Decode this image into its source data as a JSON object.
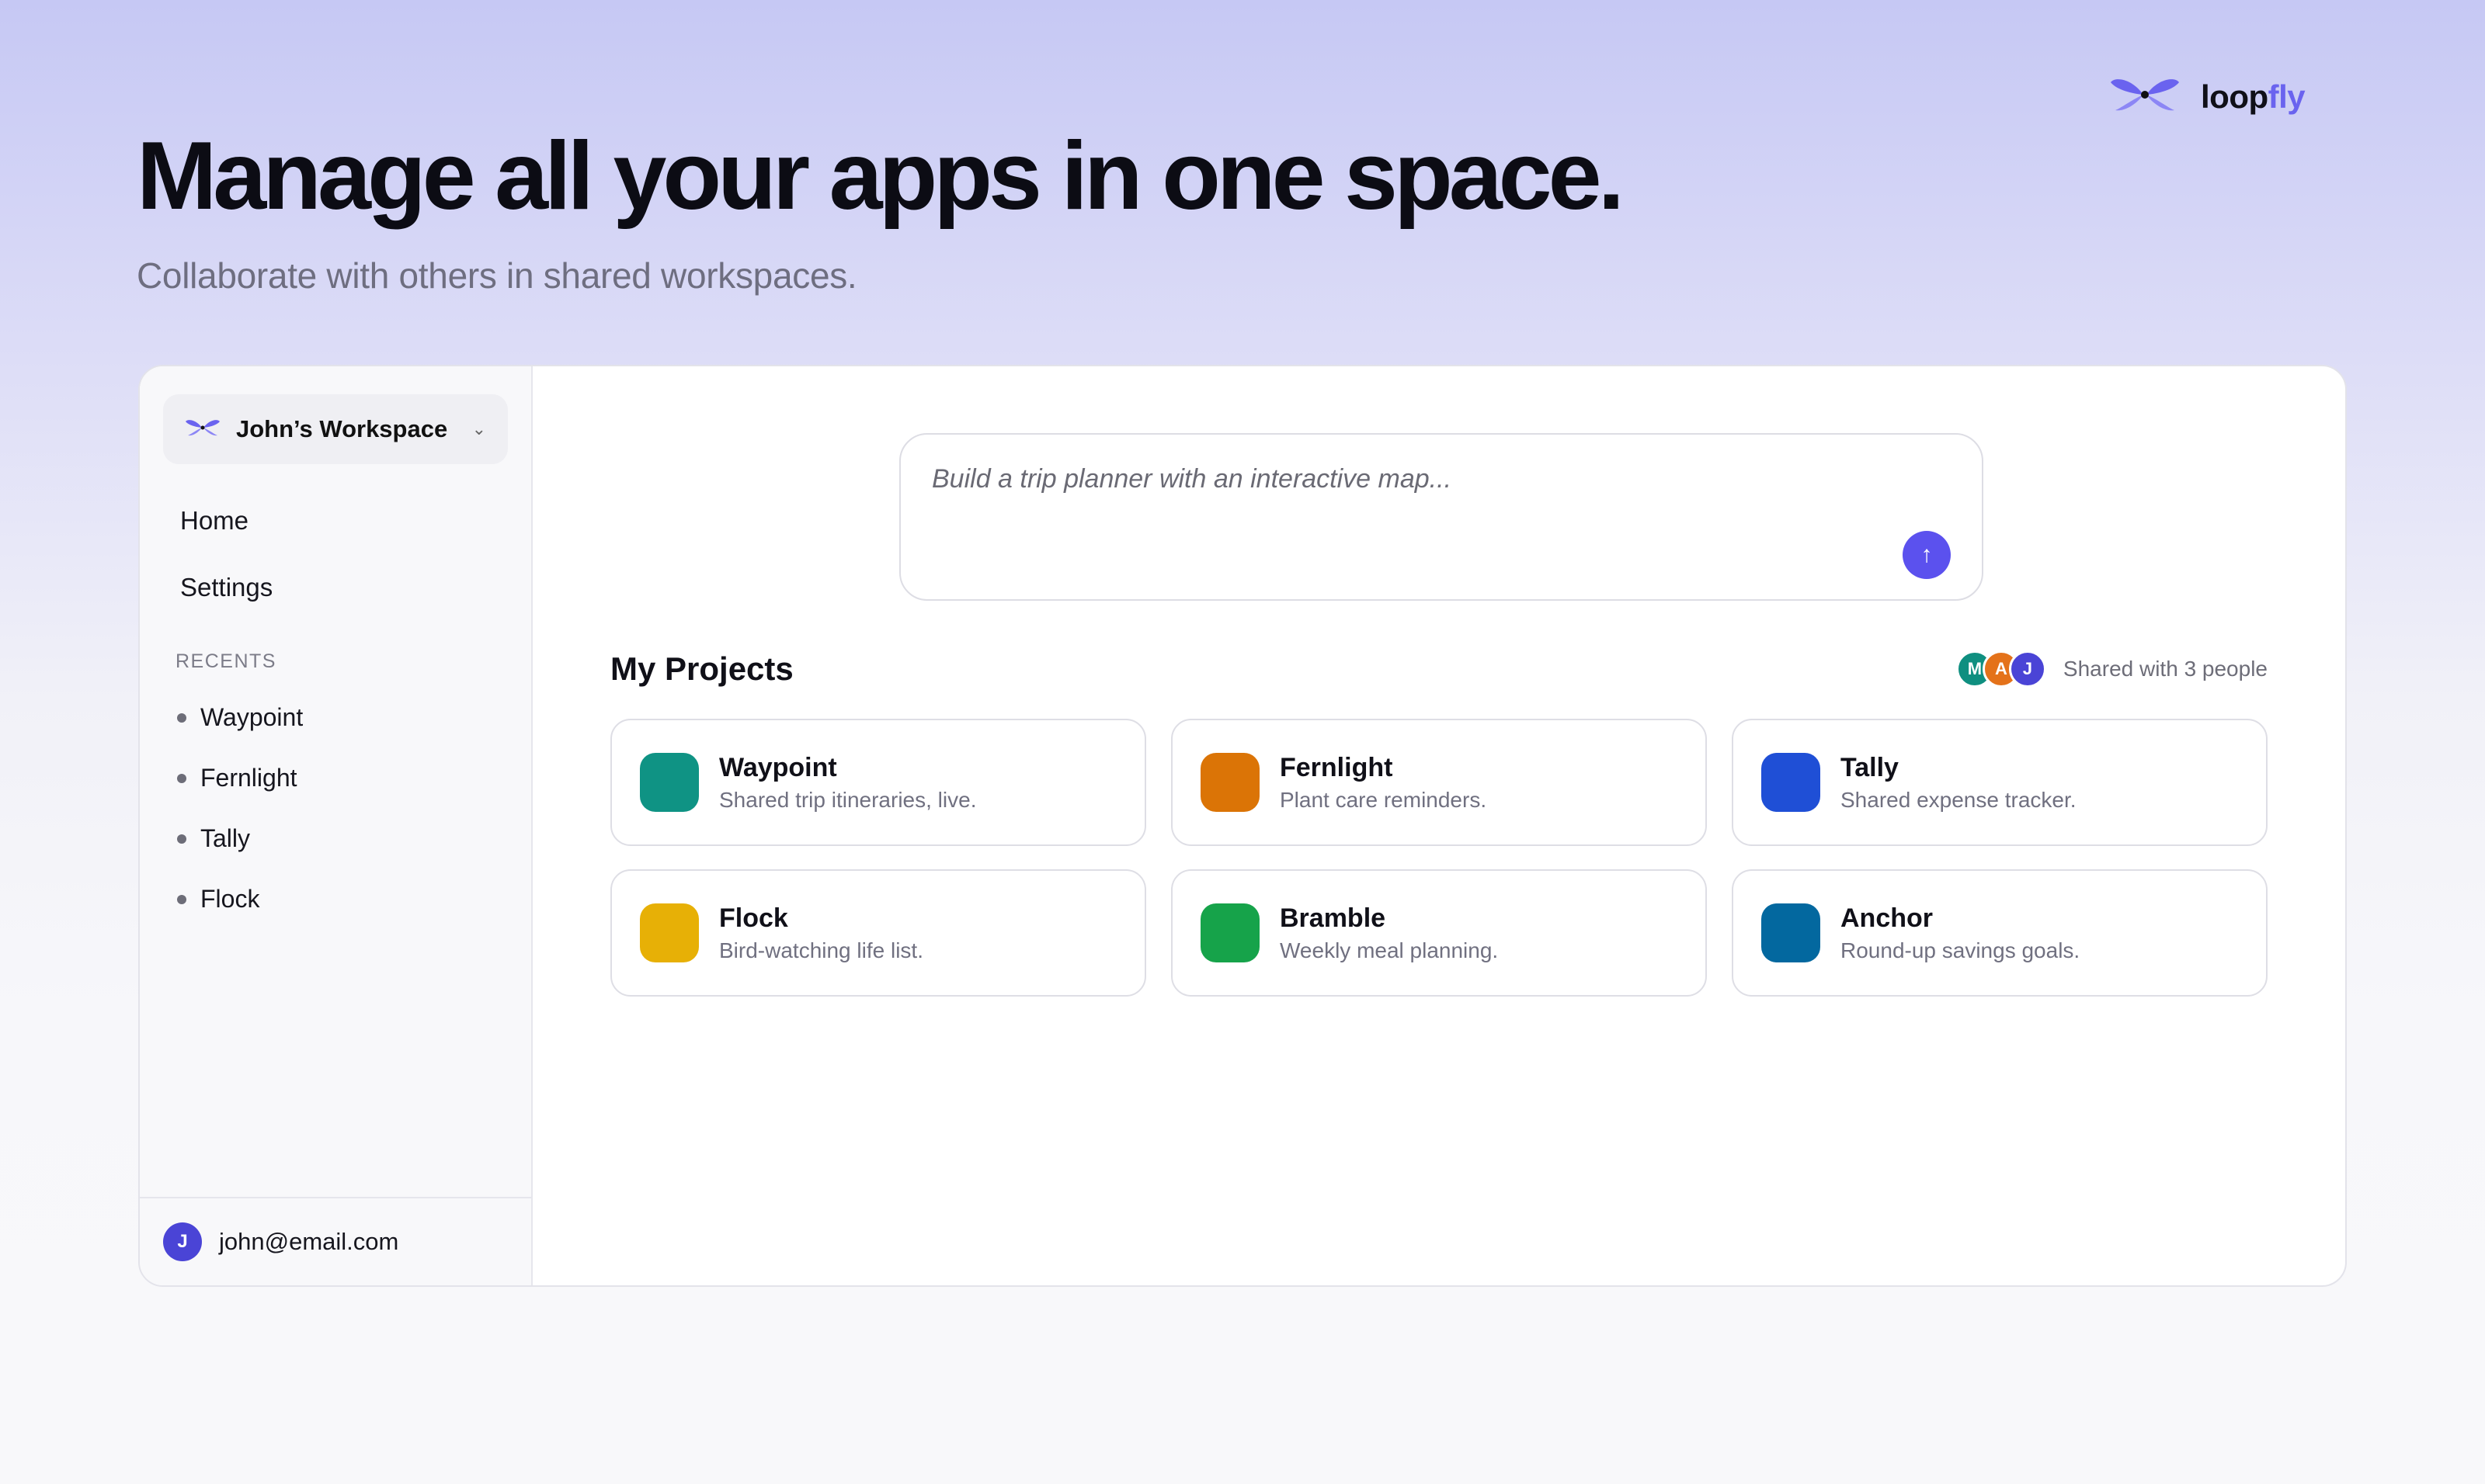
{
  "brand": {
    "name_part1": "loop",
    "name_part2": "fly",
    "icon": "butterfly-logo-icon"
  },
  "hero": {
    "title": "Manage all your apps in one space.",
    "subtitle": "Collaborate with others in shared workspaces."
  },
  "sidebar": {
    "workspace": {
      "name": "John’s Workspace",
      "icon": "butterfly-logo-icon",
      "chevron": "⌄"
    },
    "nav": [
      {
        "label": "Home"
      },
      {
        "label": "Settings"
      }
    ],
    "recents_label": "RECENTS",
    "recents": [
      {
        "label": "Waypoint"
      },
      {
        "label": "Fernlight"
      },
      {
        "label": "Tally"
      },
      {
        "label": "Flock"
      }
    ],
    "user": {
      "initial": "J",
      "email": "john@email.com"
    }
  },
  "prompt": {
    "placeholder": "Build a trip planner with an interactive map...",
    "send_icon": "↑"
  },
  "projects": {
    "title": "My Projects",
    "shared_text": "Shared with 3 people",
    "collaborators": [
      {
        "initial": "M",
        "color": "#0f8f80"
      },
      {
        "initial": "A",
        "color": "#e4721a"
      },
      {
        "initial": "J",
        "color": "#4a44d6"
      }
    ],
    "items": [
      {
        "name": "Waypoint",
        "desc": "Shared trip itineraries, live.",
        "color": "#0f9384"
      },
      {
        "name": "Fernlight",
        "desc": "Plant care reminders.",
        "color": "#db7406"
      },
      {
        "name": "Tally",
        "desc": "Shared expense tracker.",
        "color": "#1f4fd6"
      },
      {
        "name": "Flock",
        "desc": "Bird-watching life list.",
        "color": "#e7b006"
      },
      {
        "name": "Bramble",
        "desc": "Weekly meal planning.",
        "color": "#16a34a"
      },
      {
        "name": "Anchor",
        "desc": "Round-up savings goals.",
        "color": "#03689f"
      }
    ]
  },
  "colors": {
    "accent": "#5b51ee",
    "brand_purple": "#6a63ef"
  }
}
